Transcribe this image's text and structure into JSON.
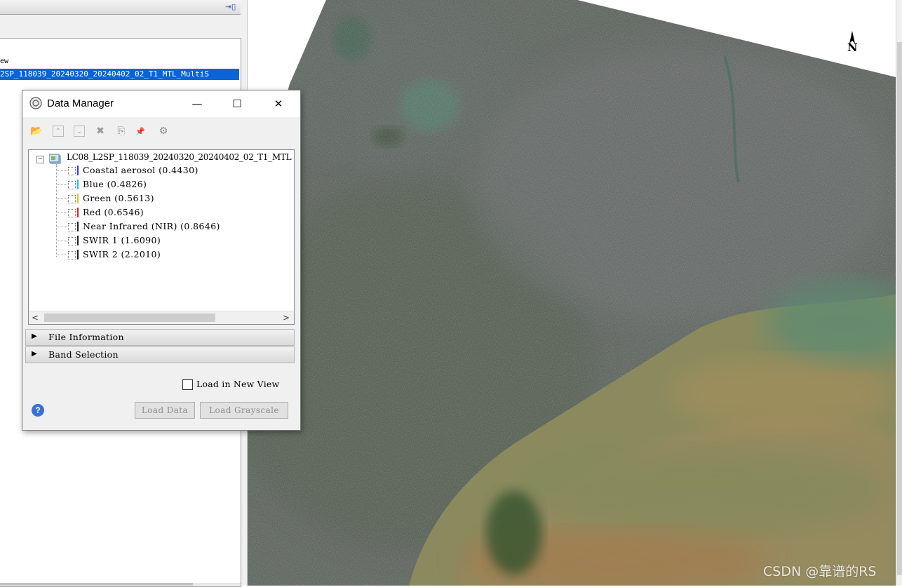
{
  "left_panel": {
    "tree_view_label": "ew",
    "selected_layer": "2SP_118039_20240320_20240402_02_T1_MTL_MultiS"
  },
  "data_manager": {
    "title": "Data Manager",
    "window_buttons": {
      "minimize": "—",
      "maximize": "☐",
      "close": "✕"
    },
    "toolbar": [
      {
        "name": "open-file-icon",
        "glyph": "📂"
      },
      {
        "name": "collapse-all-icon",
        "glyph": "⌃"
      },
      {
        "name": "expand-all-icon",
        "glyph": "⌄"
      },
      {
        "name": "close-file-icon",
        "glyph": "✖"
      },
      {
        "name": "close-all-icon",
        "glyph": "⎘"
      },
      {
        "name": "pin-icon",
        "glyph": "📌"
      },
      {
        "name": "options-icon",
        "glyph": "⚙"
      }
    ],
    "file_name": "LC08_L2SP_118039_20240320_20240402_02_T1_MTL",
    "bands": [
      {
        "label": "Coastal aerosol (0.4430)",
        "color": "#2a3bff"
      },
      {
        "label": "Blue (0.4826)",
        "color": "#17c5e8"
      },
      {
        "label": "Green (0.5613)",
        "color": "#c8d21e"
      },
      {
        "label": "Red (0.6546)",
        "color": "#e81b1b"
      },
      {
        "label": "Near Infrared (NIR) (0.8646)",
        "color": "#202020"
      },
      {
        "label": "SWIR 1 (1.6090)",
        "color": "#202020"
      },
      {
        "label": "SWIR 2 (2.2010)",
        "color": "#202020"
      }
    ],
    "sections": {
      "file_information": "File Information",
      "band_selection": "Band Selection"
    },
    "load_new_view": "Load in New View",
    "help": "?",
    "load_data": "Load Data",
    "load_grayscale": "Load Grayscale"
  },
  "map": {
    "north_label": "N",
    "watermark": "CSDN @靠谱的RS"
  }
}
